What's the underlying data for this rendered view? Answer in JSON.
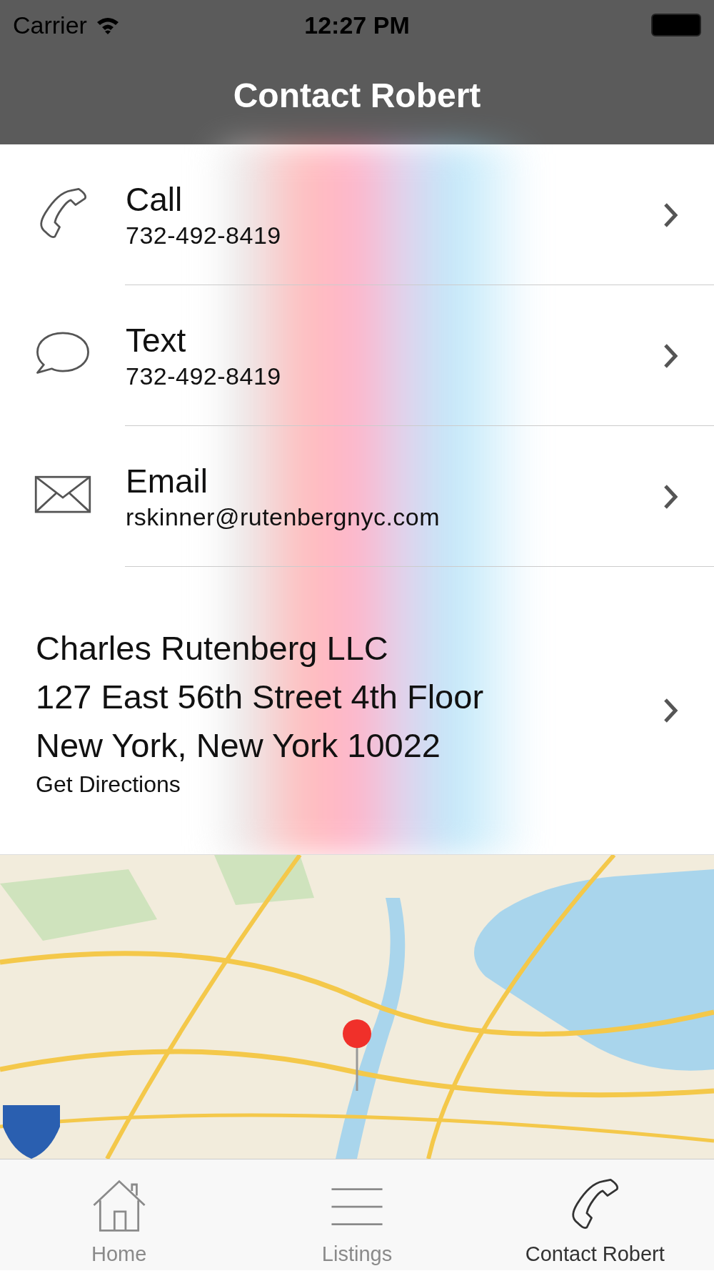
{
  "status_bar": {
    "carrier": "Carrier",
    "time": "12:27 PM"
  },
  "nav_bar": {
    "title": "Contact Robert"
  },
  "contact_rows": [
    {
      "kind": "call",
      "label": "Call",
      "detail": "732-492-8419"
    },
    {
      "kind": "text",
      "label": "Text",
      "detail": "732-492-8419"
    },
    {
      "kind": "email",
      "label": "Email",
      "detail": "rskinner@rutenbergnyc.com"
    }
  ],
  "address": {
    "lines": [
      "Charles Rutenberg LLC",
      "127 East 56th Street 4th Floor",
      "New York, New York 10022"
    ],
    "link": "Get Directions"
  },
  "tab_bar": [
    {
      "kind": "home",
      "label": "Home",
      "selected": false
    },
    {
      "kind": "listings",
      "label": "Listings",
      "selected": false
    },
    {
      "kind": "contact",
      "label": "Contact Robert",
      "selected": true
    }
  ]
}
